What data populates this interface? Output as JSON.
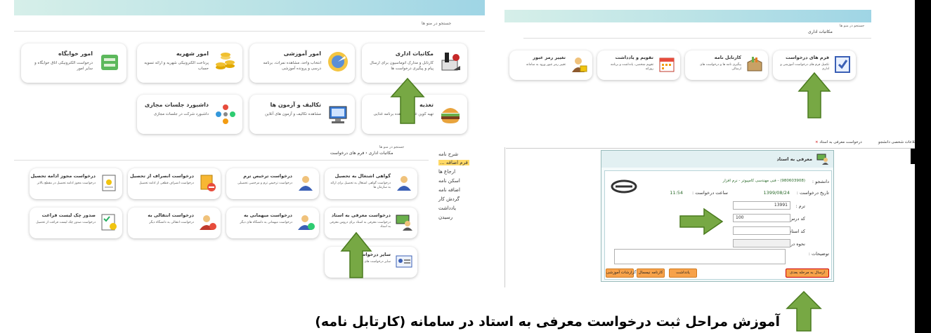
{
  "panel_top_left": {
    "search_text": "جستجو در منو ها",
    "tiles": [
      {
        "title": "مکاتبات اداری",
        "desc": "کارتابل و مدارک اتوماسیون برای ارسال پیام و پیگیری درخواست ها",
        "icon": "office-icon"
      },
      {
        "title": "امور آموزشی",
        "desc": "انتخاب واحد، مشاهده نمرات، برنامه درسی و پرونده آموزشی",
        "icon": "education-icon"
      },
      {
        "title": "امور شهریه",
        "desc": "پرداخت الکترونیکی شهریه و ارائه تسویه حساب",
        "icon": "coins-icon"
      },
      {
        "title": "امور خوابگاه",
        "desc": "درخواست الکترونیکی اتاق خوابگاه و سایر امور",
        "icon": "dorm-icon"
      },
      {
        "title": "تغذیه",
        "desc": "تهیه کوپن غذا و مشاهده برنامه غذایی",
        "icon": "food-icon"
      },
      {
        "title": "تکالیف و آزمون ها",
        "desc": "مشاهده تکالیف و آزمون های آنلاین",
        "icon": "exam-icon"
      },
      {
        "title": "داشبورد جلسات مجازی",
        "desc": "داشبورد شرکت در جلسات مجازی",
        "icon": "meeting-icon"
      }
    ]
  },
  "panel_top_right": {
    "top_crumb": "جستجو در منو ها",
    "breadcrumb": "مکاتبات اداری",
    "tiles": [
      {
        "title": "فرم های درخواست",
        "desc": "تکمیل فرم های درخواست آموزشی و اداری",
        "icon": "form-icon"
      },
      {
        "title": "کارتابل نامه",
        "desc": "پیگیری نامه ها و درخواست های ارسالی",
        "icon": "box-icon"
      },
      {
        "title": "تقویم و یادداشت",
        "desc": "تقویم شخصی، یادداشت و برنامه روزانه",
        "icon": "calendar-icon"
      },
      {
        "title": "تغییر رمز عبور",
        "desc": "تغییر رمز عبور ورود به سامانه",
        "icon": "user-lock-icon"
      }
    ]
  },
  "panel_bottom_left": {
    "top_crumb": "جستجو در منو ها",
    "breadcrumb_1": "مکاتبات اداری",
    "breadcrumb_2": "فرم های درخواست",
    "tiles": [
      {
        "title": "گواهی اشتغال به تحصیل",
        "desc": "درخواست گواهی اشتغال به تحصیل برای ارائه به سازمان ها"
      },
      {
        "title": "درخواست ترخیص ترم",
        "desc": "درخواست ترخیص ترم و مرخصی تحصیلی"
      },
      {
        "title": "درخواست انصراف از تحصیل",
        "desc": "درخواست انصراف قطعی از ادامه تحصیل"
      },
      {
        "title": "درخواست مجوز ادامه تحصیل",
        "desc": "درخواست مجوز ادامه تحصیل در مقطع بالاتر"
      },
      {
        "title": "درخواست معرفی به استاد",
        "desc": "درخواست معرفی به استاد برای دروس معرفی به استاد"
      },
      {
        "title": "درخواست میهمانی به",
        "desc": "درخواست میهمانی به دانشگاه های دیگر"
      },
      {
        "title": "درخواست انتقالی به",
        "desc": "درخواست انتقالی به دانشگاه دیگر"
      },
      {
        "title": "صدور چک لیست فراغت",
        "desc": "درخواست صدور چک لیست فراغت از تحصیل"
      },
      {
        "title": "سایر درخواست ها",
        "desc": "سایر درخواست های دانشجو"
      }
    ],
    "sidebar": [
      "شرح نامه",
      "فرم اضافه ...",
      "ارجاع ها",
      "اسکن نامه",
      "اضافه نامه",
      "گردش کار",
      "یادداشت",
      "رسیدن"
    ]
  },
  "panel_bottom_right": {
    "tabs": [
      "اطلاعات شخصی دانشجو",
      "درخواست معرفی به استاد"
    ],
    "form_title": "معرفی به استاد",
    "student_label": "دانشجو :",
    "student_value": "(980603908) - فنی مهندسی کامپیوتر - نرم افزار",
    "request_date_label": "تاریخ درخواست :",
    "request_date_value": "1399/08/24",
    "request_time_label": "ساعت درخواست :",
    "request_time_value": "11:54",
    "term_label": "ترم :",
    "term_value": "13991",
    "course_code_label": "کد درس :",
    "course_code_value": "100",
    "teacher_code_label": "کد استاد :",
    "course_group_label": "نحوه درس :",
    "description_label": "توضیحات :",
    "buttons": [
      "گزارشات آموزشی",
      "کارنامه نیمسال",
      "یادداشت",
      "ارسال به مرحله بعدی"
    ]
  },
  "caption": "آموزش مراحل ثبت درخواست معرفی به استاد در سامانه (کارتابل نامه)"
}
